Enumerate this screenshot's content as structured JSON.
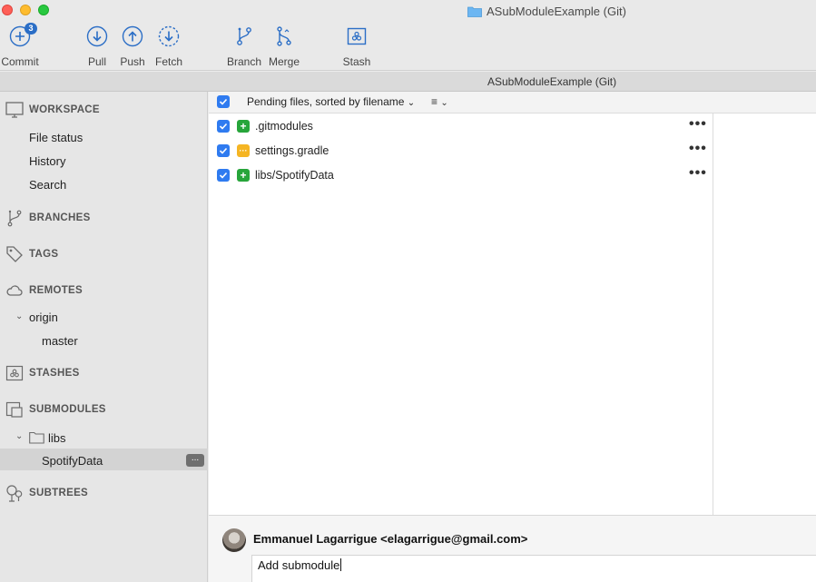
{
  "window": {
    "title": "ASubModuleExample (Git)"
  },
  "toolbar": {
    "commit": {
      "label": "Commit",
      "badge": "3"
    },
    "pull": {
      "label": "Pull"
    },
    "push": {
      "label": "Push"
    },
    "fetch": {
      "label": "Fetch"
    },
    "branch": {
      "label": "Branch"
    },
    "merge": {
      "label": "Merge"
    },
    "stash": {
      "label": "Stash"
    }
  },
  "repo_tab": "ASubModuleExample (Git)",
  "sidebar": {
    "workspace": {
      "title": "WORKSPACE",
      "items": [
        "File status",
        "History",
        "Search"
      ]
    },
    "branches": {
      "title": "BRANCHES"
    },
    "tags": {
      "title": "TAGS"
    },
    "remotes": {
      "title": "REMOTES",
      "remote": "origin",
      "branch": "master"
    },
    "stashes": {
      "title": "STASHES"
    },
    "submodules": {
      "title": "SUBMODULES",
      "folder": "libs",
      "selected": "SpotifyData",
      "more_label": "..."
    },
    "subtrees": {
      "title": "SUBTREES"
    }
  },
  "files": {
    "sort_label": "Pending files, sorted by filename",
    "list_mode_icon": "list-icon",
    "rows": [
      {
        "name": ".gitmodules",
        "status": "added",
        "status_color": "#27a53a",
        "checked": true
      },
      {
        "name": "settings.gradle",
        "status": "modified",
        "status_color": "#f5b523",
        "checked": true
      },
      {
        "name": "libs/SpotifyData",
        "status": "added",
        "status_color": "#27a53a",
        "checked": true
      }
    ],
    "row_menu": "•••"
  },
  "commit": {
    "author": "Emmanuel Lagarrigue <elagarrigue@gmail.com>",
    "message": "Add submodule"
  },
  "colors": {
    "accent": "#2f7bf0",
    "toolbar_icon": "#2b6ec6",
    "added": "#27a53a",
    "modified": "#f5b523"
  }
}
